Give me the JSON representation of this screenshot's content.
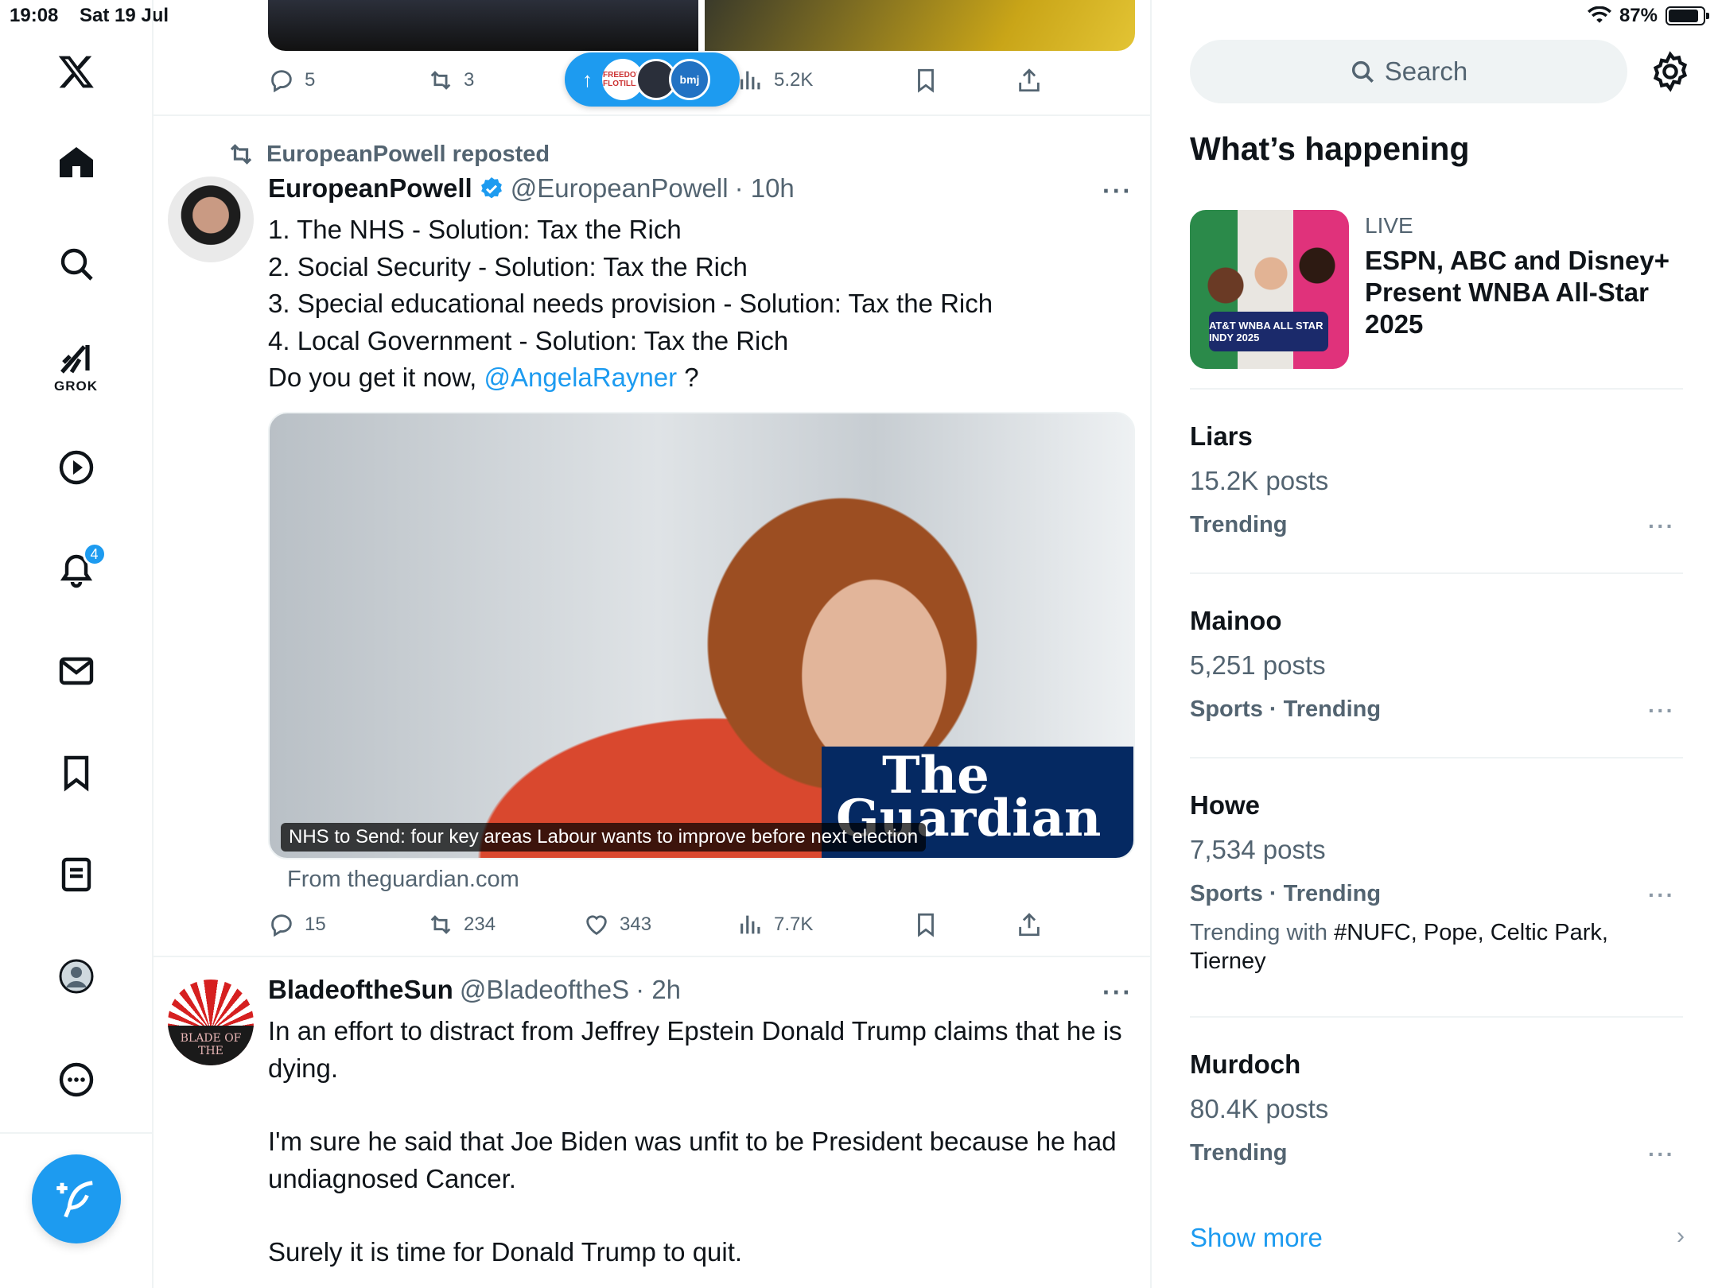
{
  "status": {
    "time": "19:08",
    "date": "Sat 19 Jul",
    "battery": "87%",
    "battery_fraction": 0.87
  },
  "nav": {
    "grok_label": "GROK",
    "notif_count": "4",
    "icons": [
      "x-logo-icon",
      "home-icon",
      "search-icon",
      "grok-icon",
      "video-icon",
      "bell-icon",
      "mail-icon",
      "bookmark-icon",
      "list-icon",
      "profile-icon",
      "more-icon",
      "compose-icon"
    ]
  },
  "prev_post": {
    "replies": "5",
    "reposts": "3",
    "views": "5.2K",
    "new_posts": {
      "av1": "FREEDOM FLOTILLA",
      "av3": "bmj"
    }
  },
  "post1": {
    "repost_label": "EuropeanPowell reposted",
    "name": "EuropeanPowell",
    "handle": "@EuropeanPowell",
    "time": "· 10h",
    "lines": [
      "1. The NHS - Solution: Tax the Rich",
      "2. Social Security - Solution: Tax the Rich",
      "3. Special educational needs provision - Solution: Tax the Rich",
      "4. Local Government - Solution: Tax the Rich"
    ],
    "last_line_prefix": "Do you get it now, ",
    "mention": "@AngelaRayner",
    "last_line_suffix": " ?",
    "card": {
      "brand_line1": "The",
      "brand_line2": "Guardian",
      "caption": "NHS to Send: four key areas Labour wants to improve before next election",
      "source": "From theguardian.com"
    },
    "replies": "15",
    "reposts": "234",
    "likes": "343",
    "views": "7.7K"
  },
  "post2": {
    "name": "BladeoftheSun",
    "handle": "@BladeoftheS",
    "time": "· 2h",
    "avatar_text": "BLADE OF THE",
    "para1": "In an effort to distract from Jeffrey Epstein Donald Trump claims that he is dying.",
    "para2": "I'm sure he said that Joe Biden was unfit to be President because he had undiagnosed Cancer.",
    "para3": "Surely it is time for Donald Trump to quit."
  },
  "right": {
    "search_placeholder": "Search",
    "title": "What’s happening",
    "live": {
      "label": "LIVE",
      "title": "ESPN, ABC and Disney+ Present WNBA All-Star 2025",
      "badge": "AT&T WNBA ALL STAR INDY 2025"
    },
    "trends": [
      {
        "name": "Liars",
        "posts": "15.2K posts",
        "category": "Trending"
      },
      {
        "name": "Mainoo",
        "posts": "5,251 posts",
        "category": "Sports · Trending"
      },
      {
        "name": "Howe",
        "posts": "7,534 posts",
        "category": "Sports · Trending",
        "with_prefix": "Trending with ",
        "with_tags": "#NUFC, Pope, Celtic Park, Tierney"
      },
      {
        "name": "Murdoch",
        "posts": "80.4K posts",
        "category": "Trending"
      }
    ],
    "show_more": "Show more"
  }
}
